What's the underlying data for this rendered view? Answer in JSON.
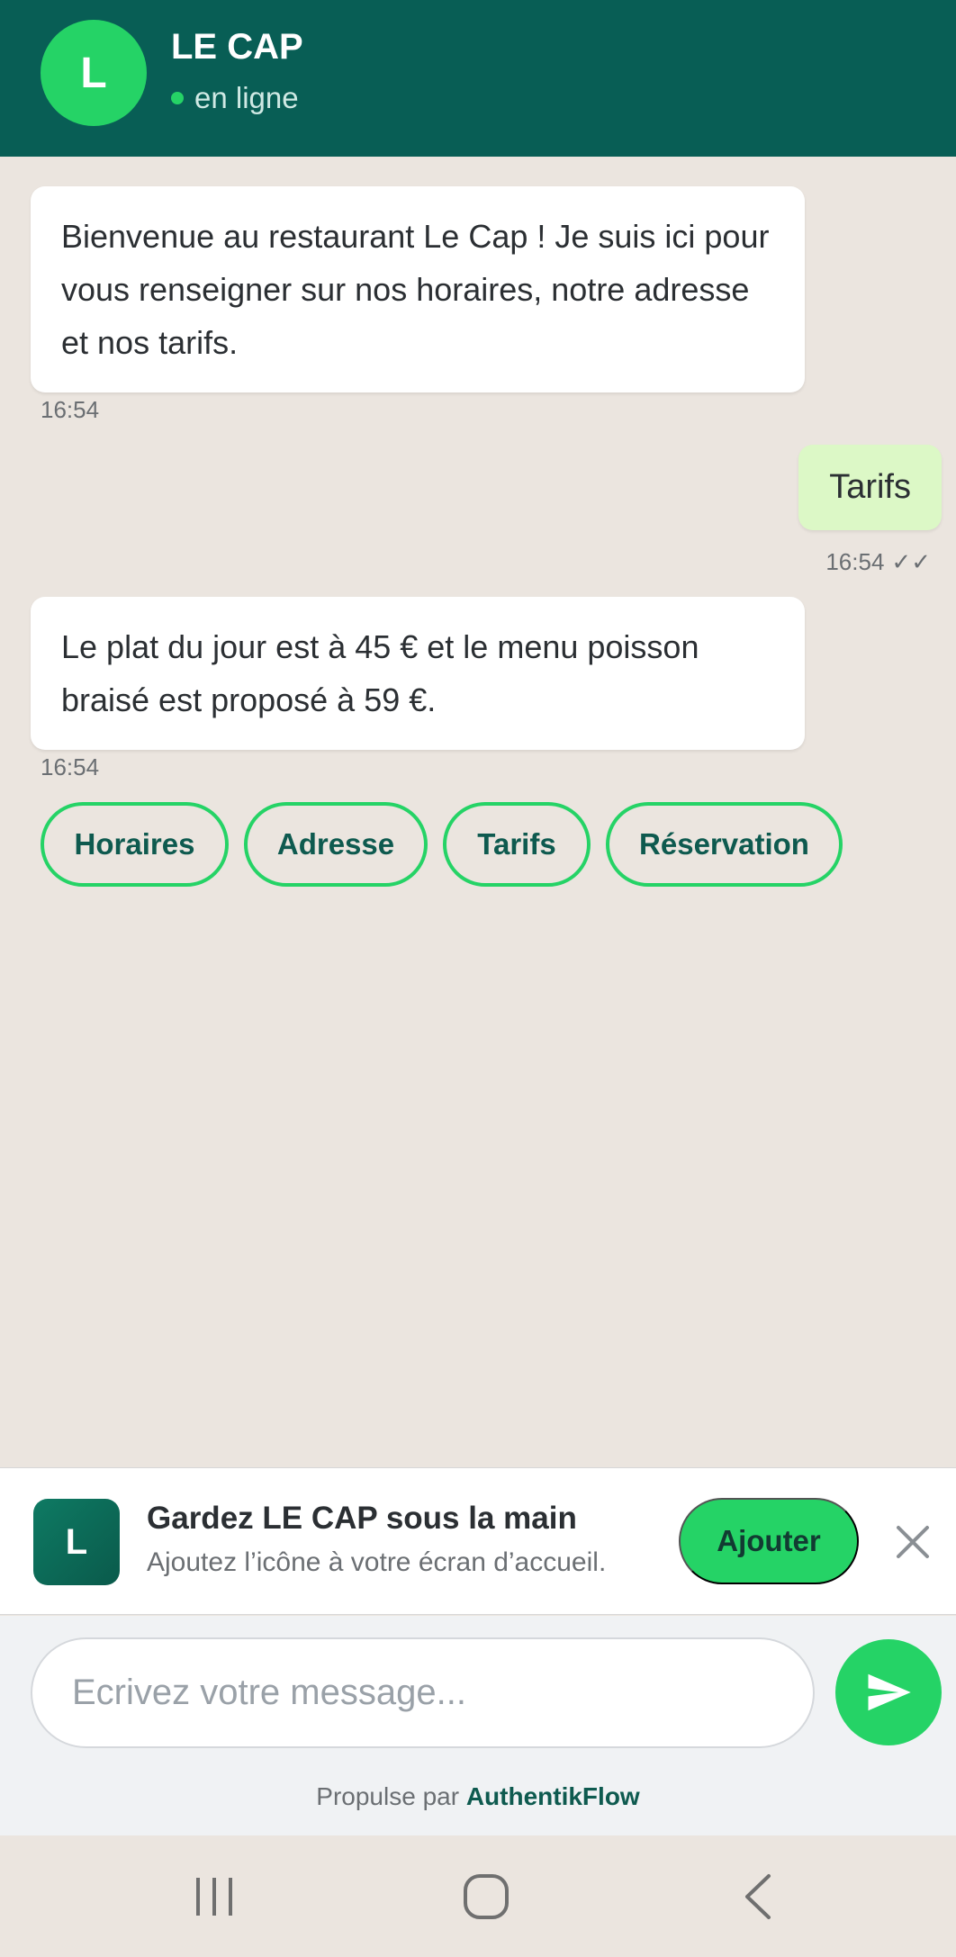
{
  "header": {
    "avatar_letter": "L",
    "name": "LE CAP",
    "status": "en ligne",
    "status_color": "#25d366",
    "background": "#085e55"
  },
  "messages": [
    {
      "direction": "in",
      "text": "Bienvenue au restaurant Le Cap ! Je suis ici pour vous renseigner sur nos horaires, notre adresse et nos tarifs.",
      "time": "16:54"
    },
    {
      "direction": "out",
      "text": "Tarifs",
      "time": "16:54",
      "read_ticks": "✓✓"
    },
    {
      "direction": "in",
      "text": "Le plat du jour est à 45 € et le menu poisson braisé est proposé à 59 €.",
      "time": "16:54"
    }
  ],
  "quick_replies": [
    "Horaires",
    "Adresse",
    "Tarifs",
    "Réservation"
  ],
  "install_banner": {
    "icon_letter": "L",
    "title": "Gardez LE CAP sous la main",
    "subtitle": "Ajoutez l’icône à votre écran d’accueil.",
    "button": "Ajouter",
    "close_icon": "close-icon"
  },
  "composer": {
    "placeholder": "Ecrivez votre message...",
    "send_icon": "send-icon",
    "powered_prefix": "Propulse par",
    "powered_brand": "AuthentikFlow"
  },
  "system_nav": {
    "icons": [
      "recent-apps-icon",
      "home-icon",
      "back-icon"
    ]
  },
  "colors": {
    "accent": "#25d366",
    "outgoing_bubble": "#dcf8c6",
    "chat_background": "#ebe5df"
  }
}
